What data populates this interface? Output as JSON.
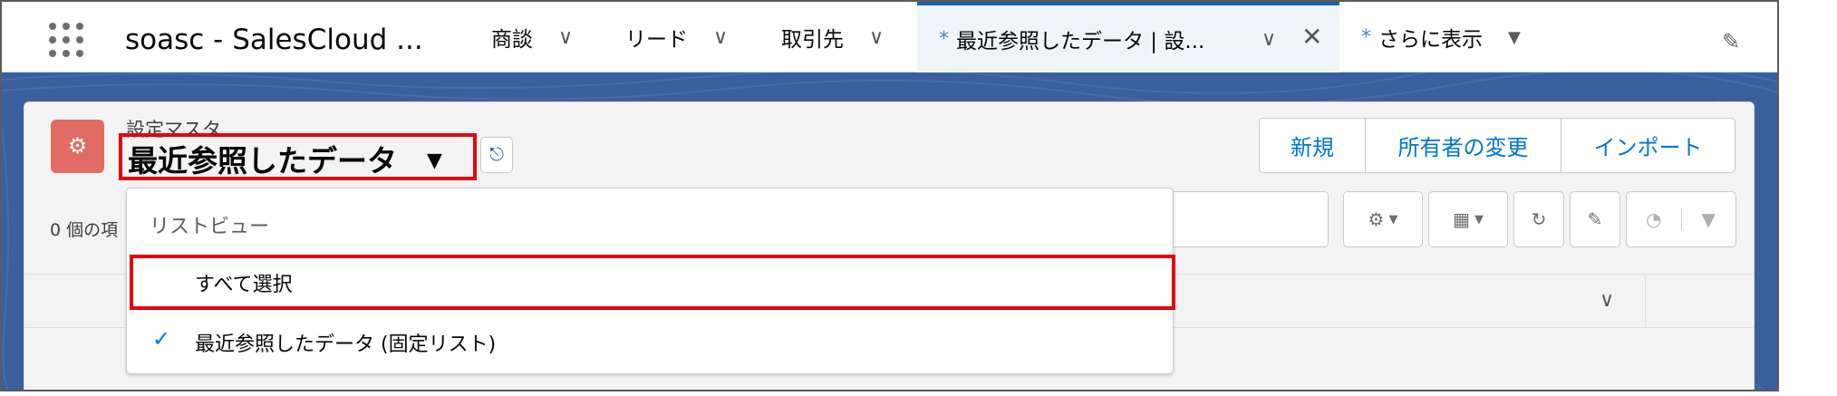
{
  "nav": {
    "app_name": "soasc - SalesCloud ...",
    "tabs": [
      {
        "label": "商談"
      },
      {
        "label": "リード"
      },
      {
        "label": "取引先"
      }
    ],
    "active_tab": {
      "marker": "*",
      "label": "最近参照したデータ | 設..."
    },
    "more": {
      "marker": "*",
      "label": "さらに表示"
    }
  },
  "header": {
    "object_label": "設定マスタ",
    "view_title": "最近参照したデータ",
    "actions": {
      "new": "新規",
      "change_owner": "所有者の変更",
      "import": "インポート"
    },
    "item_count": "0 個の項"
  },
  "dropdown": {
    "heading": "リストビュー",
    "options": [
      {
        "label": "すべて選択",
        "selected": false
      },
      {
        "label": "最近参照したデータ (固定リスト)",
        "selected": true
      }
    ]
  },
  "colors": {
    "accent": "#0176d3",
    "highlight": "#e60012",
    "icon_bg": "#e16c64",
    "background": "#3a5f9e"
  }
}
